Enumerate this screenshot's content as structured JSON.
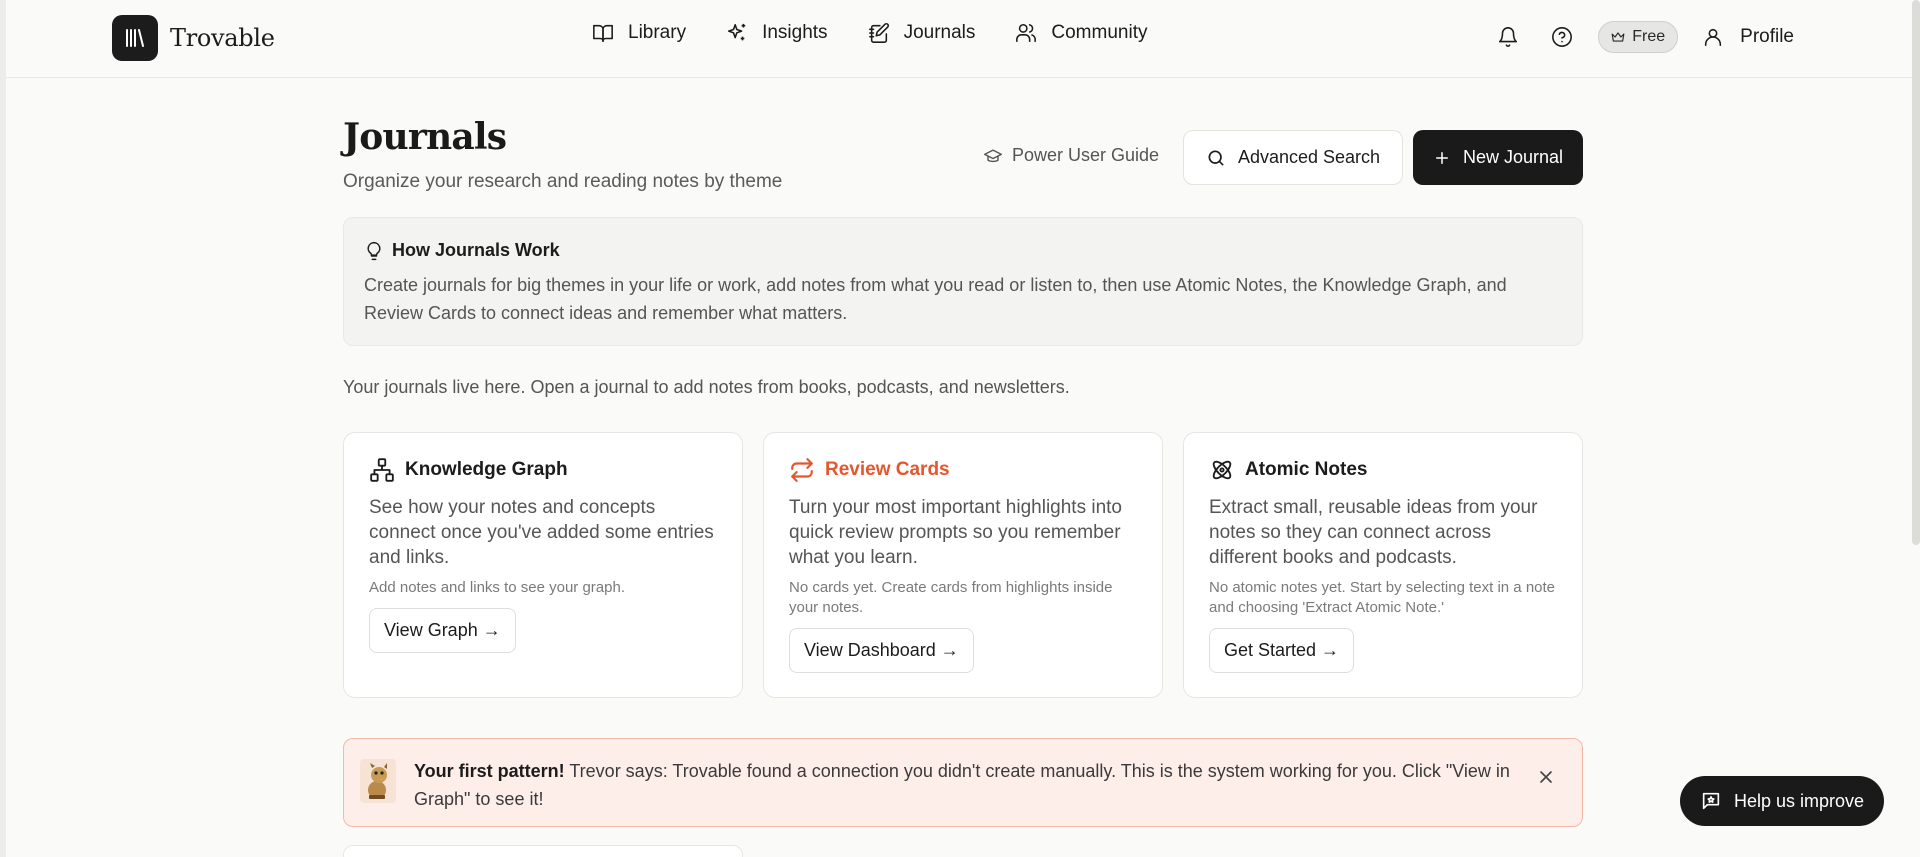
{
  "header": {
    "brand": "Trovable",
    "nav": [
      {
        "label": "Library",
        "icon": "book-icon"
      },
      {
        "label": "Insights",
        "icon": "sparkles-icon"
      },
      {
        "label": "Journals",
        "icon": "notebook-pen-icon"
      },
      {
        "label": "Community",
        "icon": "users-icon"
      }
    ],
    "plan_badge": "Free",
    "profile_label": "Profile"
  },
  "page": {
    "title": "Journals",
    "subtitle": "Organize your research and reading notes by theme",
    "guide_link": "Power User Guide",
    "advanced_search": "Advanced Search",
    "new_journal": "New Journal"
  },
  "info": {
    "title": "How Journals Work",
    "body": "Create journals for big themes in your life or work, add notes from what you read or listen to, then use Atomic Notes, the Knowledge Graph, and Review Cards to connect ideas and remember what matters."
  },
  "lead": "Your journals live here. Open a journal to add notes from books, podcasts, and newsletters.",
  "cards": [
    {
      "title": "Knowledge Graph",
      "description": "See how your notes and concepts connect once you've added some entries and links.",
      "note": "Add notes and links to see your graph.",
      "button": "View Graph →"
    },
    {
      "title": "Review Cards",
      "description": "Turn your most important highlights into quick review prompts so you remember what you learn.",
      "note": "No cards yet. Create cards from highlights inside your notes.",
      "button": "View Dashboard →"
    },
    {
      "title": "Atomic Notes",
      "description": "Extract small, reusable ideas from your notes so they can connect across different books and podcasts.",
      "note": "No atomic notes yet. Start by selecting text in a note and choosing 'Extract Atomic Note.'",
      "button": "Get Started →"
    }
  ],
  "alert": {
    "heading": "Your first pattern!",
    "message": " Trevor says: Trovable found a connection you didn't create manually. This is the system working for you. Click \"View in Graph\" to see it!"
  },
  "help_button": "Help us improve",
  "colors": {
    "accent": "#e4572e",
    "dark": "#1a1a1a",
    "alert_bg": "#fdeeea"
  }
}
